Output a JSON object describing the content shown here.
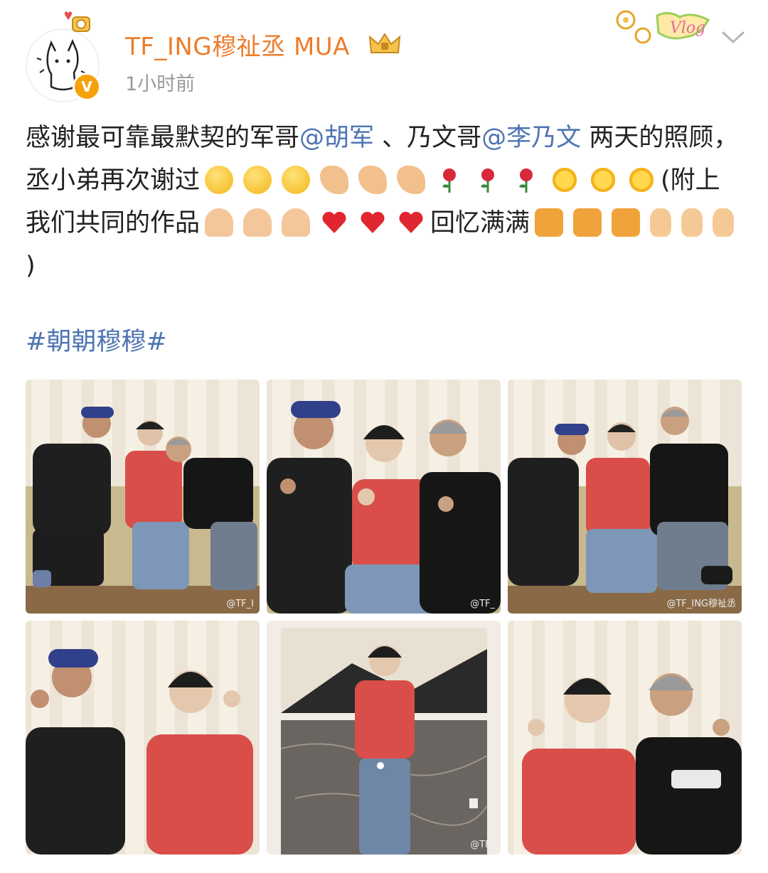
{
  "user": {
    "name": "TF_ING穆祉丞 MUA",
    "time": "1小时前",
    "verified_badge": "V"
  },
  "post": {
    "part1": "感谢最可靠最默契的军哥",
    "mention1": "@胡军",
    "part2": " 、乃文哥",
    "mention2": "@李乃文",
    "part3": " 两天的照顾，丞小弟再次谢过",
    "part4": "(附上我们共同的作品",
    "part5": "回忆满满",
    "part6": ")",
    "hashtag": "#朝朝穆穆#"
  },
  "photos": {
    "watermark1": "@TF_I",
    "watermark2": "@TF_ING穆祉丞",
    "watermark3": "@TF_"
  },
  "colors": {
    "username": "#ed7d2c",
    "link": "#4e74b2",
    "time": "#9a9a9a"
  }
}
